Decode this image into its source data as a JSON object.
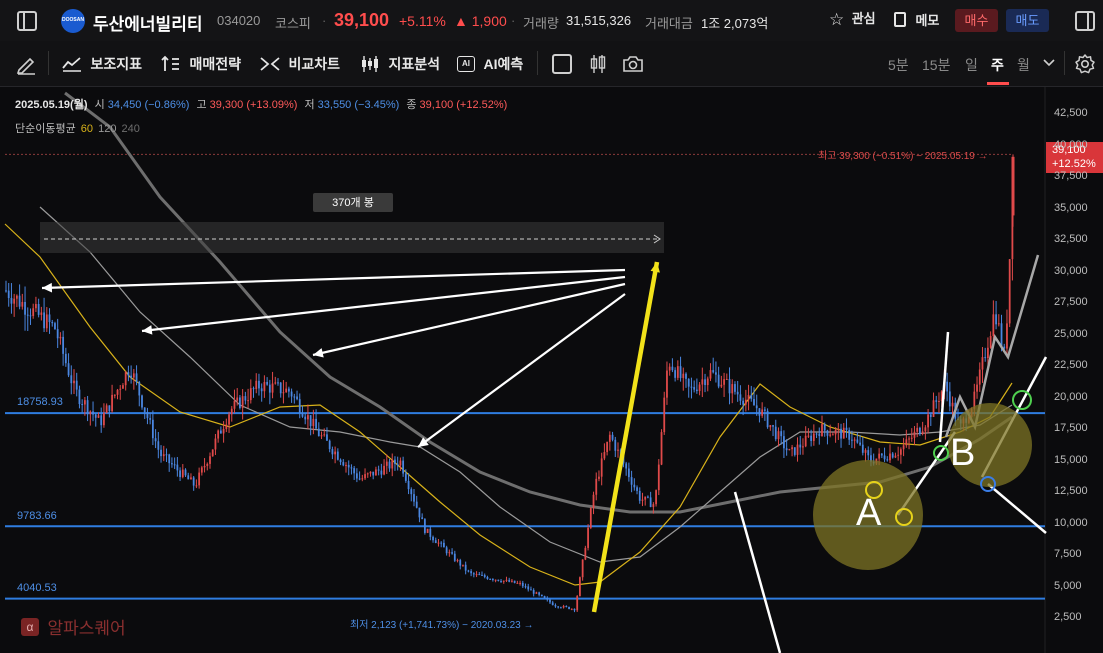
{
  "header": {
    "stock_name": "두산에너빌리티",
    "code": "034020",
    "market": "코스피",
    "price": "39,100",
    "change_pct": "+5.11%",
    "change_abs": "▲ 1,900",
    "volume_label": "거래량",
    "volume": "31,515,326",
    "amount_label": "거래대금",
    "amount": "1조 2,073억",
    "watch_label": "관심",
    "memo_label": "메모",
    "buy_label": "매수",
    "sell_label": "매도",
    "logo_text": "DOOSAN"
  },
  "toolbar": {
    "aux_indicator": "보조지표",
    "strategy": "매매전략",
    "compare": "비교차트",
    "analysis": "지표분석",
    "ai_predict": "AI예측",
    "timeframes": [
      "5분",
      "15분",
      "일",
      "주",
      "월"
    ],
    "active_timeframe": "주"
  },
  "chart_info": {
    "date": "2025.05.19(월)",
    "open_label": "시",
    "open": "34,450 (−0.86%)",
    "high_label": "고",
    "high": "39,300 (+13.09%)",
    "low_label": "저",
    "low": "33,550 (−3.45%)",
    "close_label": "종",
    "close": "39,100 (+12.52%)",
    "ma_label": "단순이동평균",
    "ma_periods": [
      "60",
      "120",
      "240"
    ]
  },
  "annotations": {
    "range_box": "370개 봉",
    "high_marker": "최고 39,300 (−0.51%) − 2025.05.19 →",
    "low_marker": "최저 2,123 (+1,741.73%) − 2020.03.23 →",
    "label_a": "A",
    "label_b": "B",
    "hline_1": "18758.93",
    "hline_2": "9783.66",
    "hline_3": "4040.53",
    "price_tag_value": "39,100",
    "price_tag_pct": "+12.52%",
    "watermark": "알파스퀘어"
  },
  "chart_data": {
    "type": "candlestick",
    "interval": "weekly",
    "y_axis_ticks": [
      "42,500",
      "40,000",
      "37,500",
      "35,000",
      "32,500",
      "30,000",
      "27,500",
      "25,000",
      "22,500",
      "20,000",
      "17,500",
      "15,000",
      "12,500",
      "10,000",
      "7,500",
      "5,000",
      "2,500"
    ],
    "y_range": [
      1000,
      44000
    ],
    "last_bar": {
      "date": "2025.05.19",
      "open": 34450,
      "high": 39300,
      "low": 33550,
      "close": 39100
    },
    "all_time_low": {
      "date": "2020.03.23",
      "value": 2123
    },
    "horizontal_lines": [
      18758.93,
      9783.66,
      4040.53
    ],
    "moving_averages": [
      {
        "name": "60",
        "color": "#d8b21a"
      },
      {
        "name": "120",
        "color": "#9a9a9a"
      },
      {
        "name": "240",
        "color": "#6e6e6e"
      }
    ],
    "series_colors": {
      "up": "#e04a4a",
      "down": "#4a86e0"
    }
  }
}
